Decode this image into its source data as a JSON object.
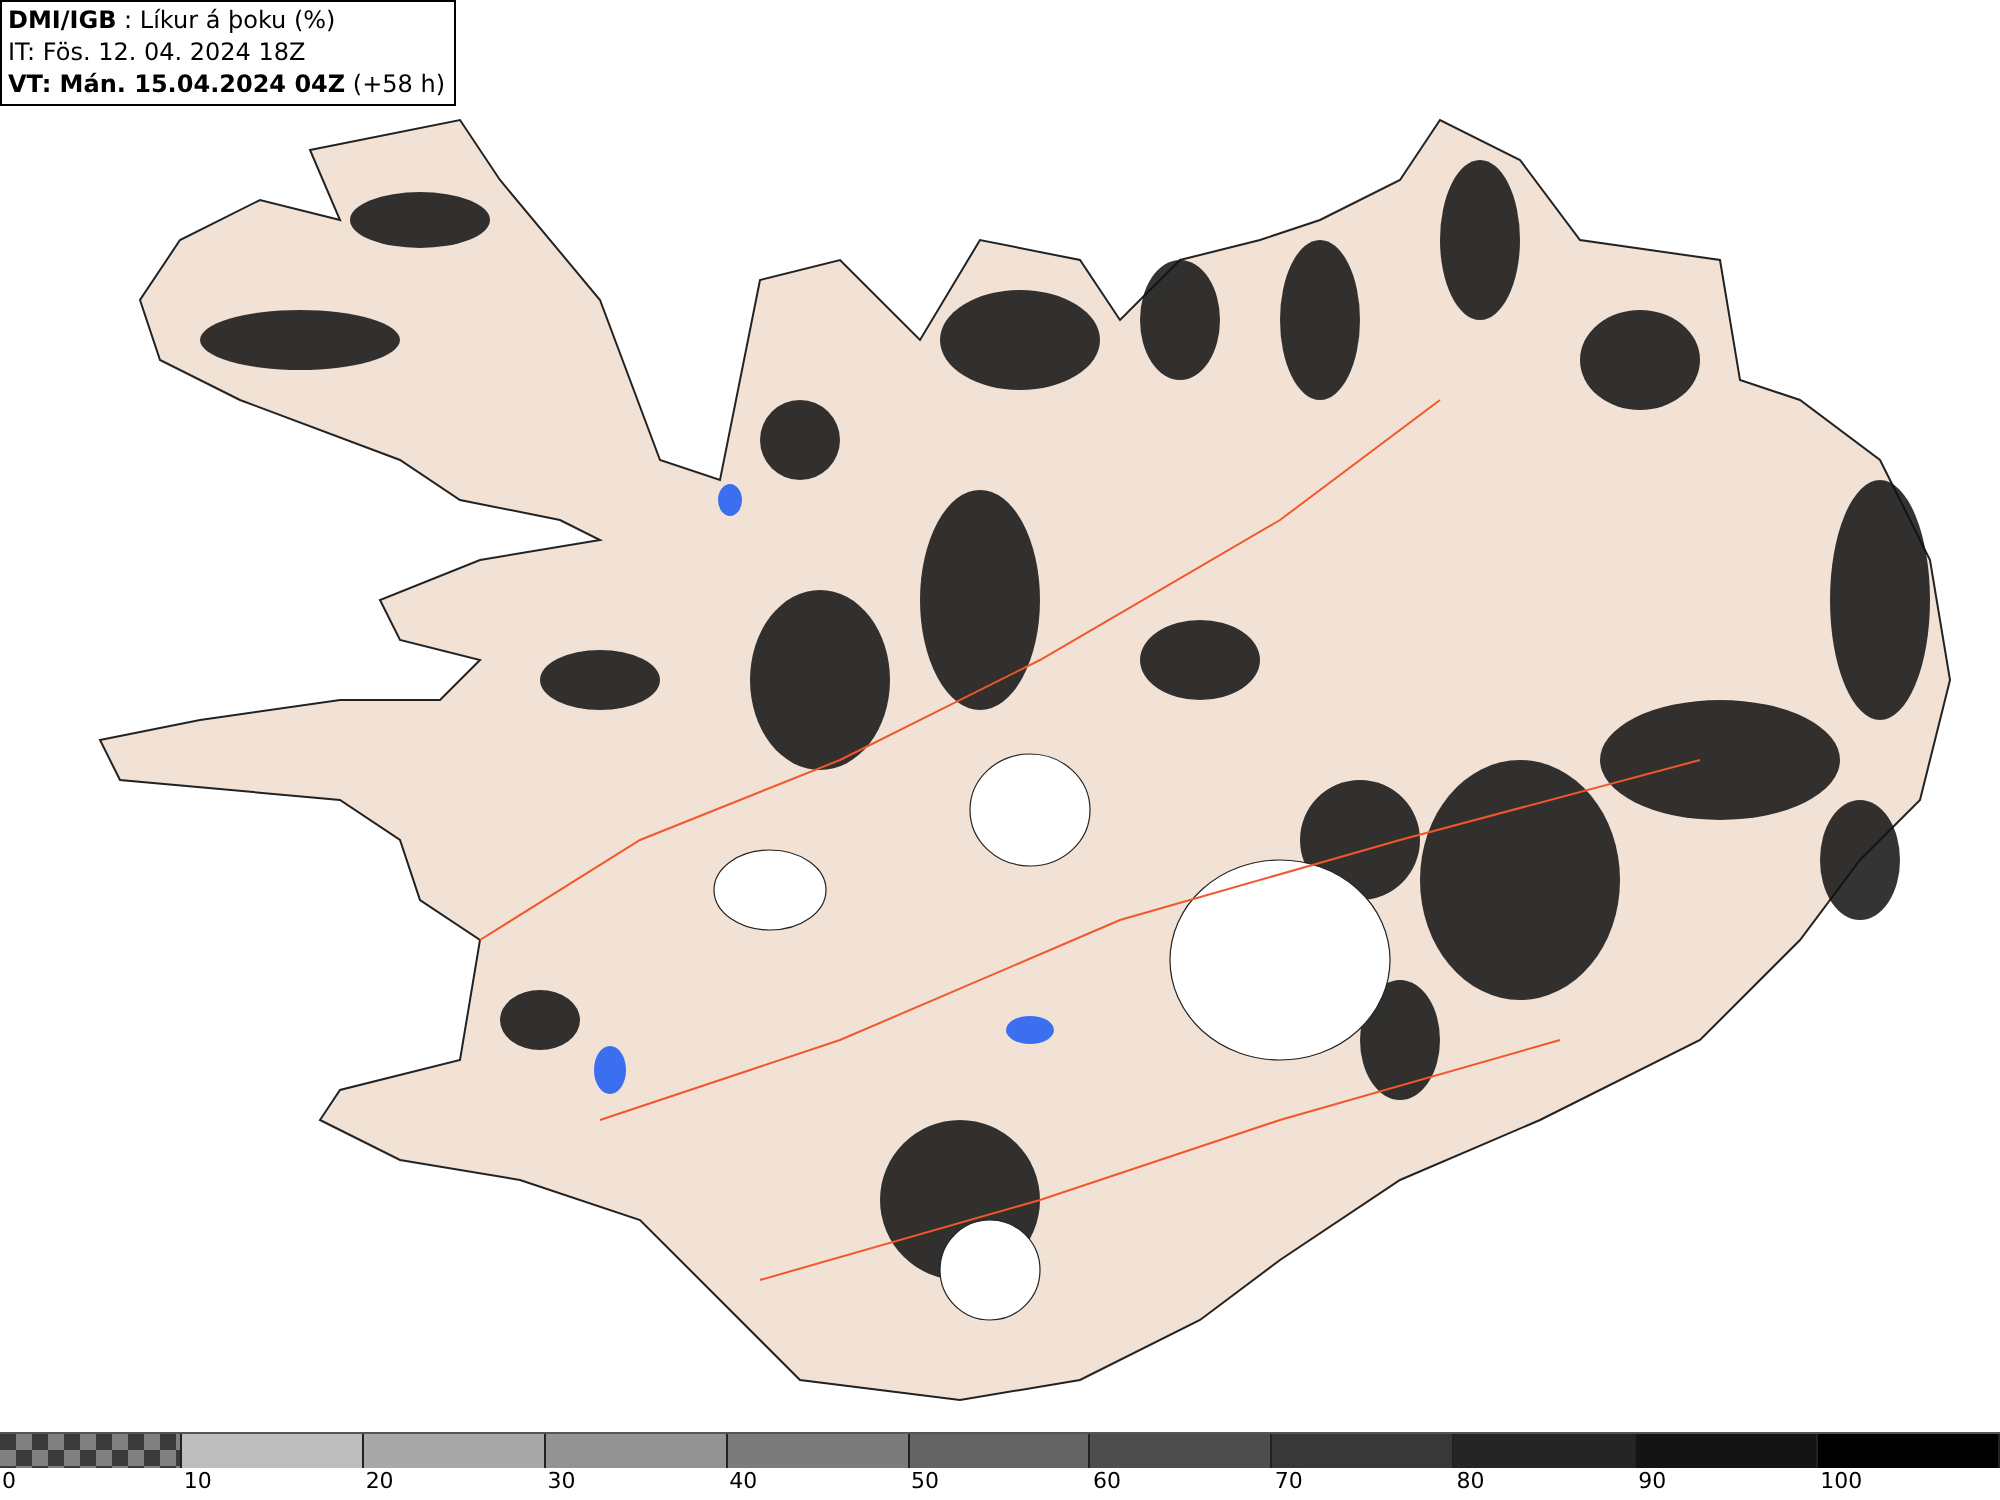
{
  "header": {
    "lines": [
      "**DMI/IGB** : Líkur á þoku (%)",
      "IT: Fös. 12. 04. 2024 18Z",
      "**VT: Mán. 15.04.2024 04Z** (+58 h)"
    ]
  },
  "legend": {
    "segments": [
      {
        "label": "0",
        "kind": "checker",
        "color": "#808080"
      },
      {
        "label": "10",
        "kind": "solid",
        "color": "#bdbdbd"
      },
      {
        "label": "20",
        "kind": "solid",
        "color": "#a8a8a8"
      },
      {
        "label": "30",
        "kind": "solid",
        "color": "#939393"
      },
      {
        "label": "40",
        "kind": "solid",
        "color": "#7b7b7b"
      },
      {
        "label": "50",
        "kind": "solid",
        "color": "#646464"
      },
      {
        "label": "60",
        "kind": "solid",
        "color": "#4d4d4d"
      },
      {
        "label": "70",
        "kind": "solid",
        "color": "#383838"
      },
      {
        "label": "80",
        "kind": "solid",
        "color": "#252525"
      },
      {
        "label": "90",
        "kind": "solid",
        "color": "#141414"
      },
      {
        "label": "100",
        "kind": "solid",
        "color": "#000000"
      }
    ]
  }
}
